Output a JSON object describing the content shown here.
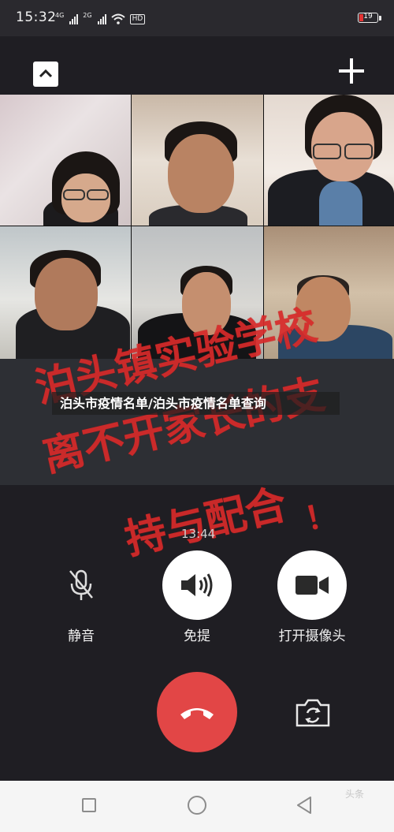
{
  "status_bar": {
    "time": "15:32",
    "sim1": "4G",
    "sim2": "2G",
    "network_badge": "HD",
    "battery": "19",
    "battery_color": "#e33333"
  },
  "call": {
    "timer": "13:44",
    "headline": "泊头市疫情名单/泊头市疫情名单查询",
    "stamp_lines": [
      "泊头镇实验学校",
      "离不开家长的支",
      "持与配合",
      "！"
    ],
    "controls": {
      "mute_label": "静音",
      "speaker_label": "免提",
      "camera_label": "打开摄像头"
    },
    "hangup_color": "#e24646",
    "stamp_color": "#d82a2a"
  },
  "navigation": {
    "watermark": "头条"
  },
  "icons": [
    "chevron-up-icon",
    "plus-icon",
    "microphone-off-icon",
    "speaker-icon",
    "video-camera-icon",
    "hangup-phone-icon",
    "switch-camera-icon",
    "recents-square-icon",
    "home-circle-icon",
    "back-triangle-icon"
  ]
}
